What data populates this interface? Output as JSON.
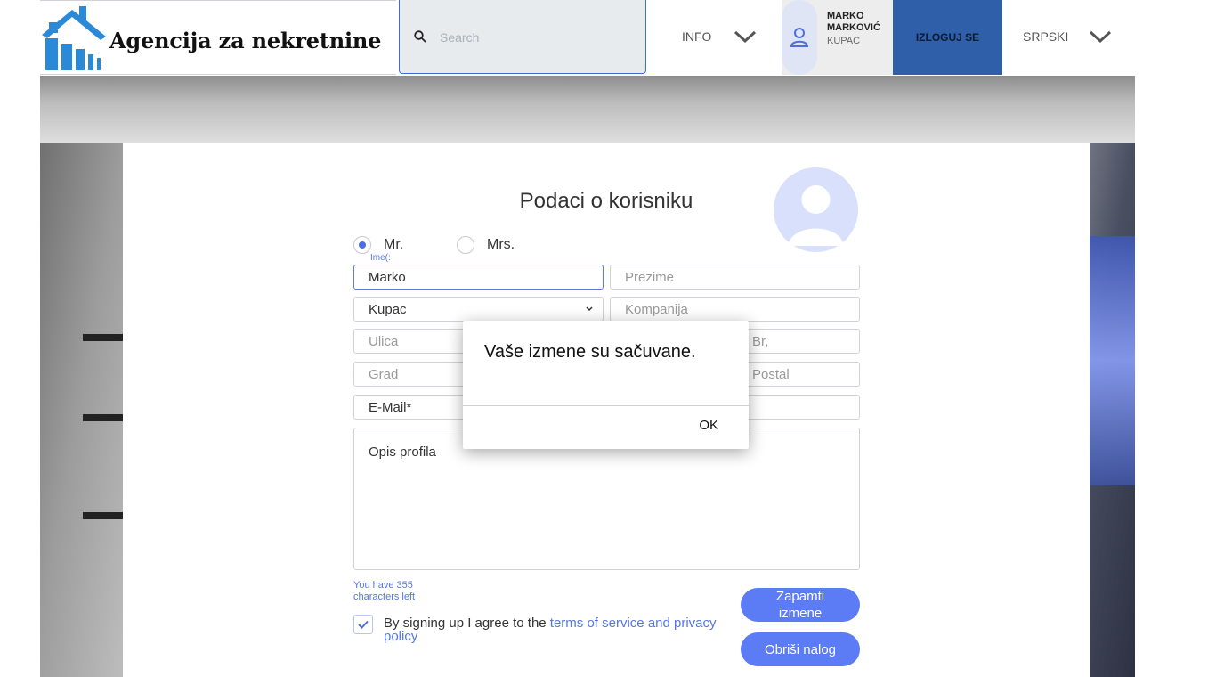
{
  "header": {
    "logo_text": "Agencija za nekretnine",
    "search_placeholder": "Search",
    "info_label": "INFO",
    "user": {
      "name": "MARKO MARKOVIĆ",
      "role": "KUPAC"
    },
    "logout_label": "IZLOGUJ SE",
    "language_label": "SRPSKI"
  },
  "form": {
    "title": "Podaci o korisniku",
    "salutation": {
      "options": [
        "Mr.",
        "Mrs."
      ],
      "selected": "Mr."
    },
    "first_name_label": "Ime(:",
    "first_name_value": "Marko",
    "last_name_placeholder": "Prezime",
    "user_type_value": "Kupac",
    "company_placeholder": "Kompanija",
    "street_placeholder": "Ulica",
    "number_placeholder": "Br,",
    "city_placeholder": "Grad",
    "postal_placeholder": "Postal",
    "email_value": "E-Mail*",
    "description_value": "Opis profila",
    "chars_left": "You have 355 characters left",
    "agree_checked": true,
    "agree_text": "By signing up I agree to the ",
    "agree_link": "terms of service and privacy policy",
    "save_label": "Zapamti izmene",
    "delete_label": "Obriši nalog"
  },
  "dialog": {
    "message": "Vaše izmene su sačuvane.",
    "ok_label": "OK"
  },
  "colors": {
    "accent": "#5b7cf4",
    "logout_bg": "#2e5fa8",
    "logo_blue": "#2a8ad8"
  }
}
